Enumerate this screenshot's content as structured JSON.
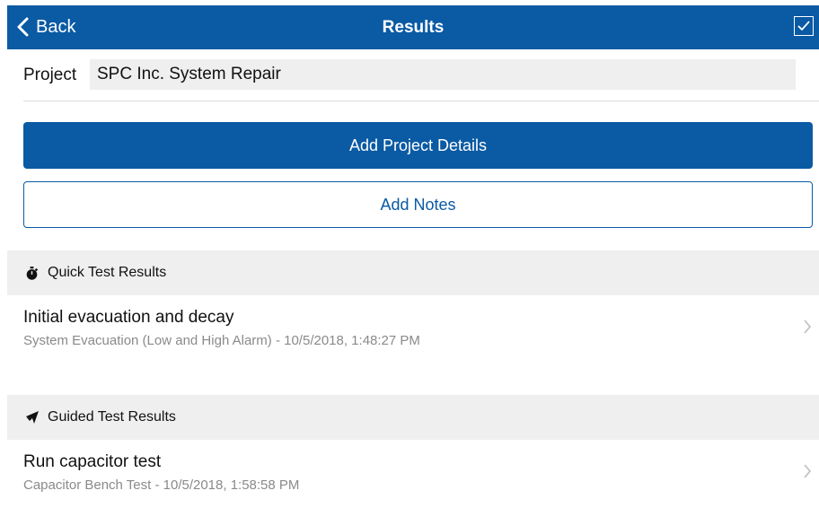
{
  "header": {
    "back_label": "Back",
    "title": "Results"
  },
  "project": {
    "label": "Project",
    "value": "SPC Inc. System Repair"
  },
  "buttons": {
    "add_details": "Add Project Details",
    "add_notes": "Add Notes"
  },
  "sections": [
    {
      "header": "Quick Test Results",
      "icon": "stopwatch-icon",
      "items": [
        {
          "title": "Initial evacuation and decay",
          "subtitle": "System Evacuation (Low and High Alarm) - 10/5/2018, 1:48:27 PM"
        }
      ]
    },
    {
      "header": "Guided Test Results",
      "icon": "guided-test-icon",
      "items": [
        {
          "title": "Run capacitor test",
          "subtitle": "Capacitor Bench Test - 10/5/2018, 1:58:58 PM"
        }
      ]
    }
  ],
  "colors": {
    "accent": "#0a5aa4",
    "section_bg": "#efefef",
    "subtitle": "#8a8a8a"
  }
}
